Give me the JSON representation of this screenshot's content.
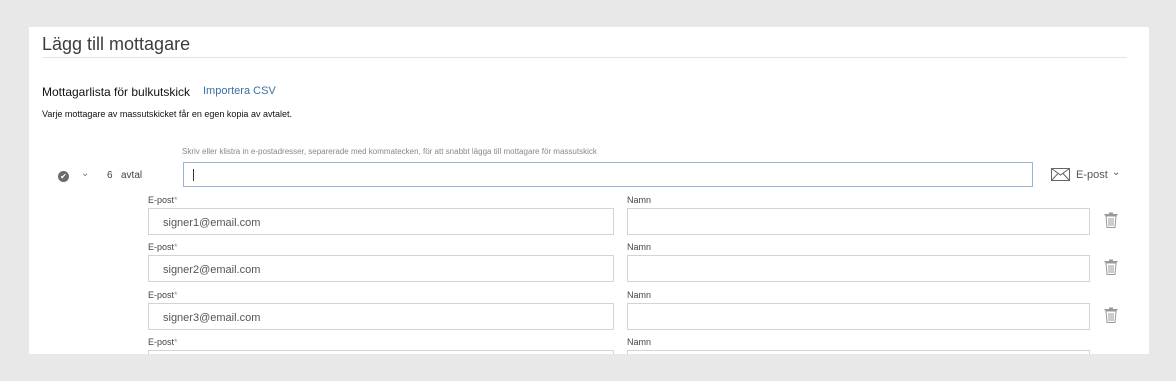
{
  "header": {
    "title": "Lägg till mottagare"
  },
  "bulk": {
    "section_title": "Mottagarlista för bulkutskick",
    "import_label": "Importera CSV",
    "description": "Varje mottagare av massutskicket får en egen kopia av avtalet.",
    "count": "6",
    "count_unit": "avtal",
    "input_hint": "Skriv eller klistra in e-postadresser, separerade med kommatecken, för att snabbt lägga till mottagare för massutskick",
    "input_value": "",
    "delivery_label": "E-post"
  },
  "recipients": {
    "email_label": "E-post",
    "required_mark": "*",
    "name_label": "Namn",
    "rows": [
      {
        "email": "signer1@email.com",
        "name": ""
      },
      {
        "email": "signer2@email.com",
        "name": ""
      },
      {
        "email": "signer3@email.com",
        "name": ""
      },
      {
        "email": "",
        "name": ""
      }
    ]
  },
  "icons": {
    "check": "check-circle-icon",
    "expand": "chevron-down-icon",
    "mail": "envelope-icon",
    "delete": "trash-icon"
  },
  "colors": {
    "link": "#3b6fa6",
    "input_focus_border": "#9bb3d6",
    "page_background": "#e8e8e8"
  }
}
